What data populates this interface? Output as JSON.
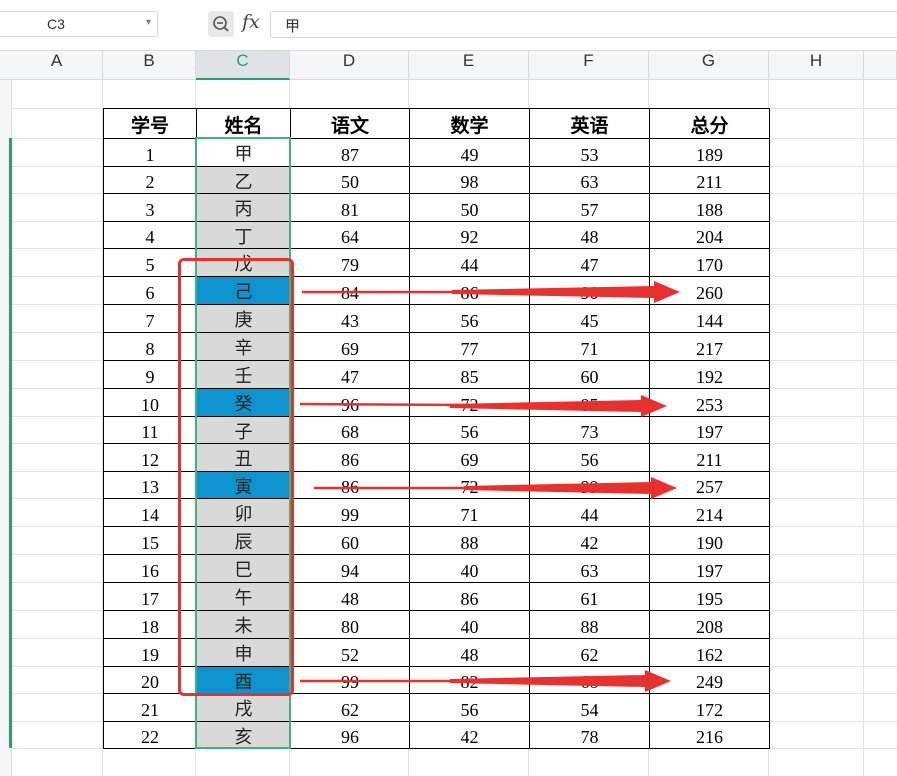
{
  "formula_bar": {
    "cell_ref": "C3",
    "fx": "fx",
    "formula": "甲",
    "zoom_icon": "zoom-icon",
    "dropdown_icon": "chevron-down-icon"
  },
  "columns": [
    "A",
    "B",
    "C",
    "D",
    "E",
    "F",
    "G",
    "H"
  ],
  "selected_column": "C",
  "table": {
    "headers": [
      "学号",
      "姓名",
      "语文",
      "数学",
      "英语",
      "总分"
    ],
    "rows": [
      [
        "1",
        "甲",
        "87",
        "49",
        "53",
        "189"
      ],
      [
        "2",
        "乙",
        "50",
        "98",
        "63",
        "211"
      ],
      [
        "3",
        "丙",
        "81",
        "50",
        "57",
        "188"
      ],
      [
        "4",
        "丁",
        "64",
        "92",
        "48",
        "204"
      ],
      [
        "5",
        "戊",
        "79",
        "44",
        "47",
        "170"
      ],
      [
        "6",
        "己",
        "84",
        "86",
        "90",
        "260"
      ],
      [
        "7",
        "庚",
        "43",
        "56",
        "45",
        "144"
      ],
      [
        "8",
        "辛",
        "69",
        "77",
        "71",
        "217"
      ],
      [
        "9",
        "壬",
        "47",
        "85",
        "60",
        "192"
      ],
      [
        "10",
        "癸",
        "96",
        "72",
        "85",
        "253"
      ],
      [
        "11",
        "子",
        "68",
        "56",
        "73",
        "197"
      ],
      [
        "12",
        "丑",
        "86",
        "69",
        "56",
        "211"
      ],
      [
        "13",
        "寅",
        "86",
        "72",
        "99",
        "257"
      ],
      [
        "14",
        "卯",
        "99",
        "71",
        "44",
        "214"
      ],
      [
        "15",
        "辰",
        "60",
        "88",
        "42",
        "190"
      ],
      [
        "16",
        "巳",
        "94",
        "40",
        "63",
        "197"
      ],
      [
        "17",
        "午",
        "48",
        "86",
        "61",
        "195"
      ],
      [
        "18",
        "未",
        "80",
        "40",
        "88",
        "208"
      ],
      [
        "19",
        "申",
        "52",
        "48",
        "62",
        "162"
      ],
      [
        "20",
        "酉",
        "99",
        "82",
        "68",
        "249"
      ],
      [
        "21",
        "戌",
        "62",
        "56",
        "54",
        "172"
      ],
      [
        "22",
        "亥",
        "96",
        "42",
        "78",
        "216"
      ]
    ],
    "highlighted_rows": [
      6,
      10,
      13,
      20
    ],
    "colors": {
      "highlight": "#0d94cf",
      "grey_fill": "#d9d9d9",
      "annotation": "#e8312f",
      "selection": "#3fb37a"
    }
  }
}
